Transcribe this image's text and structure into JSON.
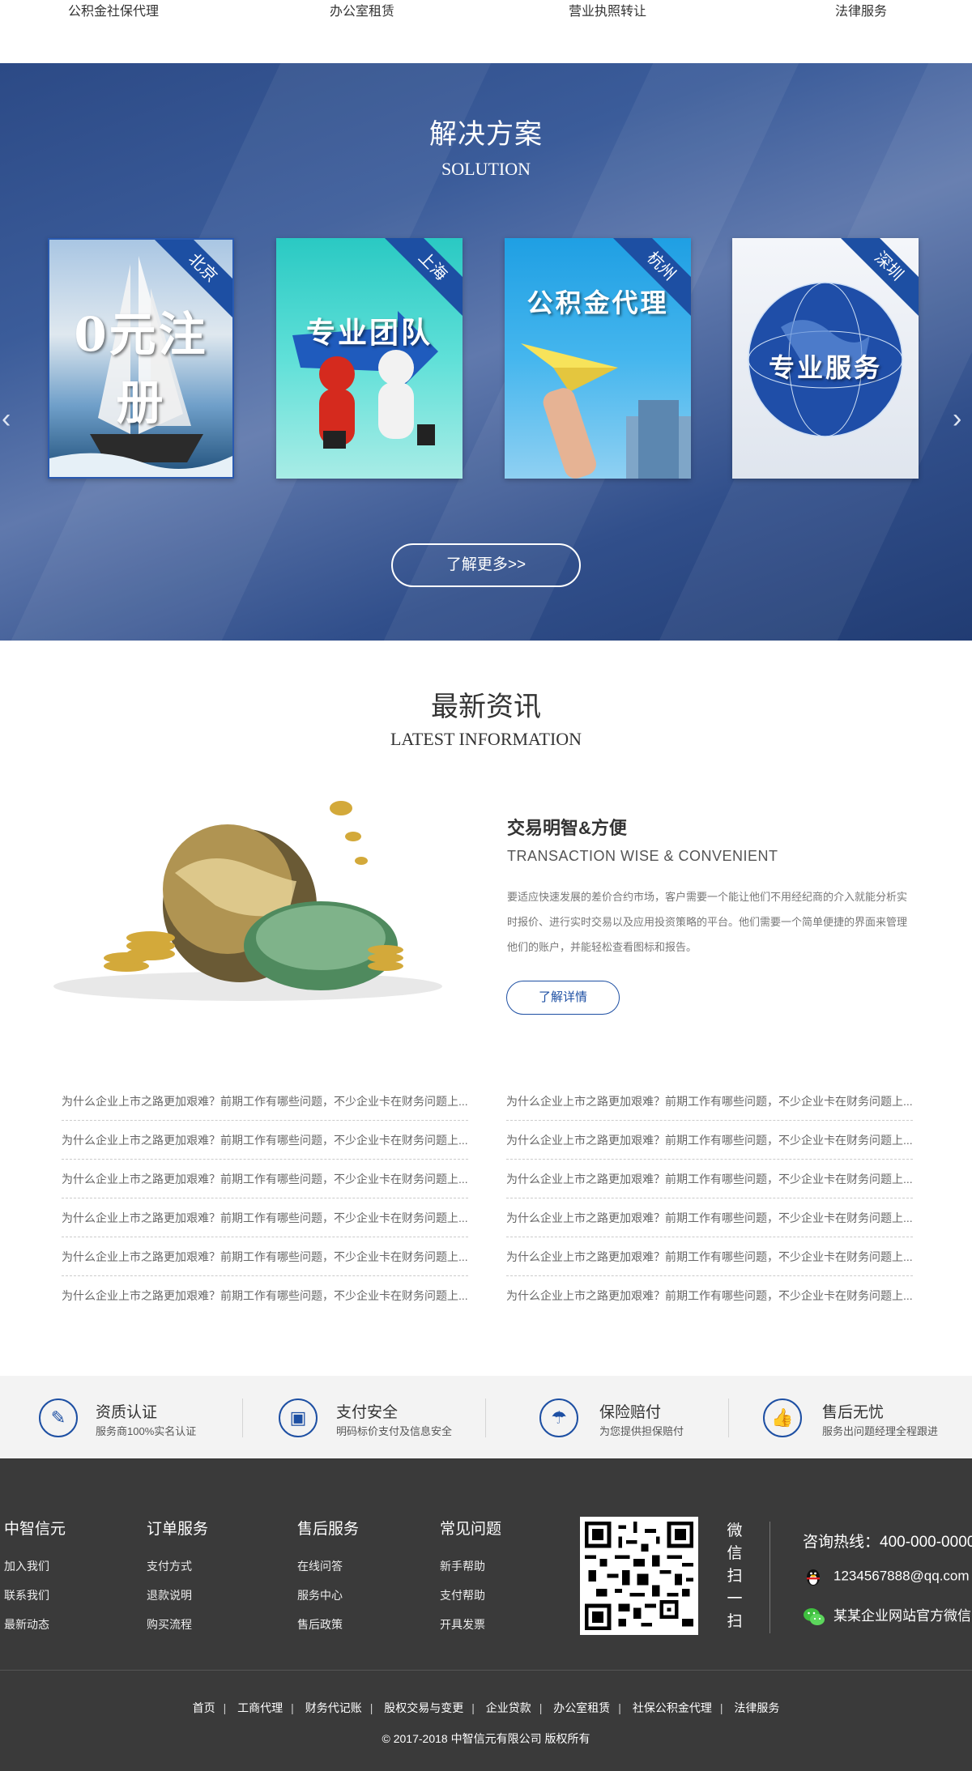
{
  "top_nav": [
    "公积金社保代理",
    "办公室租赁",
    "营业执照转让",
    "法律服务"
  ],
  "solution": {
    "title": "解决方案",
    "subtitle": "SOLUTION",
    "cards": [
      {
        "city": "北京",
        "text": "0元注册"
      },
      {
        "city": "上海",
        "text": "专业团队"
      },
      {
        "city": "杭州",
        "text": "公积金代理"
      },
      {
        "city": "深圳",
        "text": "专业服务"
      }
    ],
    "prev_arrow": "‹",
    "next_arrow": "›",
    "more_button": "了解更多>>"
  },
  "news": {
    "title": "最新资讯",
    "subtitle": "LATEST INFORMATION",
    "featured": {
      "heading": "交易明智&方便",
      "heading_en": "TRANSACTION WISE & CONVENIENT",
      "body": "要适应快速发展的差价合约市场，客户需要一个能让他们不用经纪商的介入就能分析实时报价、进行实时交易以及应用投资策略的平台。他们需要一个简单便捷的界面来管理他们的账户，并能轻松查看图标和报告。",
      "button": "了解详情"
    },
    "left_list": [
      "为什么企业上市之路更加艰难？前期工作有哪些问题，不少企业卡在财务问题上...",
      "为什么企业上市之路更加艰难？前期工作有哪些问题，不少企业卡在财务问题上...",
      "为什么企业上市之路更加艰难？前期工作有哪些问题，不少企业卡在财务问题上...",
      "为什么企业上市之路更加艰难？前期工作有哪些问题，不少企业卡在财务问题上...",
      "为什么企业上市之路更加艰难？前期工作有哪些问题，不少企业卡在财务问题上...",
      "为什么企业上市之路更加艰难？前期工作有哪些问题，不少企业卡在财务问题上..."
    ],
    "right_list": [
      "为什么企业上市之路更加艰难？前期工作有哪些问题，不少企业卡在财务问题上...",
      "为什么企业上市之路更加艰难？前期工作有哪些问题，不少企业卡在财务问题上...",
      "为什么企业上市之路更加艰难？前期工作有哪些问题，不少企业卡在财务问题上...",
      "为什么企业上市之路更加艰难？前期工作有哪些问题，不少企业卡在财务问题上...",
      "为什么企业上市之路更加艰难？前期工作有哪些问题，不少企业卡在财务问题上...",
      "为什么企业上市之路更加艰难？前期工作有哪些问题，不少企业卡在财务问题上..."
    ]
  },
  "features": [
    {
      "icon": "certificate-icon",
      "title": "资质认证",
      "desc": "服务商100%实名认证"
    },
    {
      "icon": "wallet-icon",
      "title": "支付安全",
      "desc": "明码标价支付及信息安全"
    },
    {
      "icon": "umbrella-icon",
      "title": "保险赔付",
      "desc": "为您提供担保赔付"
    },
    {
      "icon": "thumbs-up-icon",
      "title": "售后无忧",
      "desc": "服务出问题经理全程跟进"
    }
  ],
  "footer": {
    "columns": [
      {
        "title": "中智信元",
        "links": [
          "加入我们",
          "联系我们",
          "最新动态"
        ]
      },
      {
        "title": "订单服务",
        "links": [
          "支付方式",
          "退款说明",
          "购买流程"
        ]
      },
      {
        "title": "售后服务",
        "links": [
          "在线问答",
          "服务中心",
          "售后政策"
        ]
      },
      {
        "title": "常见问题",
        "links": [
          "新手帮助",
          "支付帮助",
          "开具发票"
        ]
      }
    ],
    "qr_caption": "微信扫一扫",
    "hotline": "咨询热线：400-000-0000",
    "qq": "1234567888@qq.com",
    "wechat": "某某企业网站官方微信",
    "bottom_links": [
      "首页",
      "工商代理",
      "财务代记账",
      "股权交易与变更",
      "企业贷款",
      "办公室租赁",
      "社保公积金代理",
      "法律服务"
    ],
    "copyright": "© 2017-2018 中智信元有限公司 版权所有"
  },
  "colors": {
    "brand_blue": "#1d4fa3",
    "footer_bg": "#3a3a3a",
    "feature_bar_bg": "#f3f3f3"
  }
}
